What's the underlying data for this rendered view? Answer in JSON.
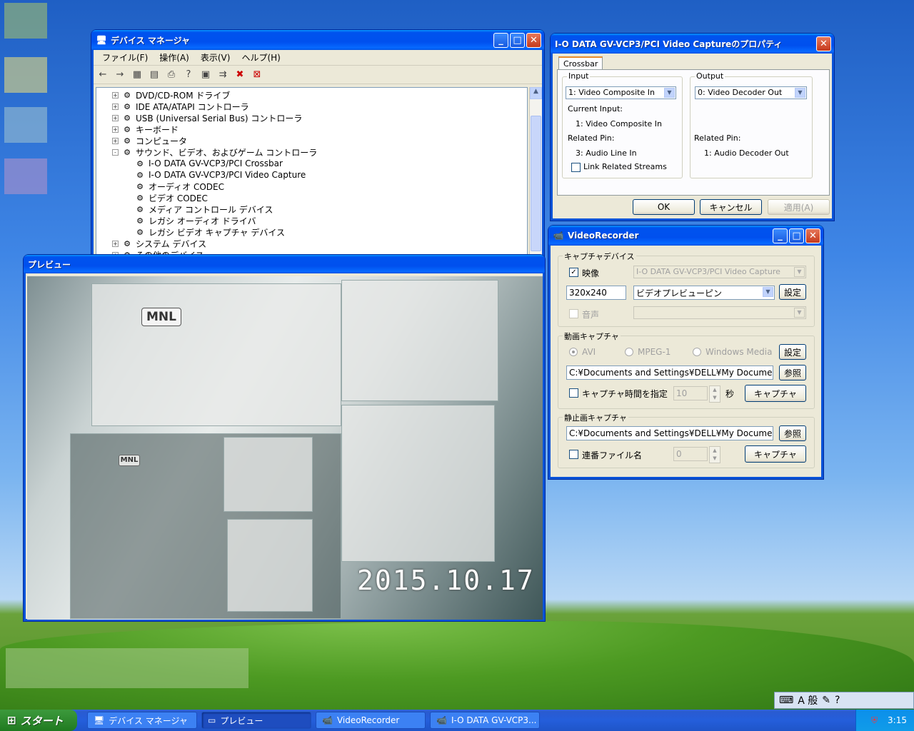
{
  "device_manager": {
    "title": "デバイス マネージャ",
    "menu": [
      "ファイル(F)",
      "操作(A)",
      "表示(V)",
      "ヘルプ(H)"
    ],
    "tree": [
      {
        "label": "DVD/CD-ROM ドライブ",
        "indent": 0,
        "expander": "+"
      },
      {
        "label": "IDE ATA/ATAPI コントローラ",
        "indent": 0,
        "expander": "+"
      },
      {
        "label": "USB (Universal Serial Bus) コントローラ",
        "indent": 0,
        "expander": "+"
      },
      {
        "label": "キーボード",
        "indent": 0,
        "expander": "+"
      },
      {
        "label": "コンピュータ",
        "indent": 0,
        "expander": "+"
      },
      {
        "label": "サウンド、ビデオ、およびゲーム コントローラ",
        "indent": 0,
        "expander": "-"
      },
      {
        "label": "I-O DATA GV-VCP3/PCI Crossbar",
        "indent": 1,
        "expander": ""
      },
      {
        "label": "I-O DATA GV-VCP3/PCI Video Capture",
        "indent": 1,
        "expander": ""
      },
      {
        "label": "オーディオ CODEC",
        "indent": 1,
        "expander": ""
      },
      {
        "label": "ビデオ CODEC",
        "indent": 1,
        "expander": ""
      },
      {
        "label": "メディア コントロール デバイス",
        "indent": 1,
        "expander": ""
      },
      {
        "label": "レガシ オーディオ ドライバ",
        "indent": 1,
        "expander": ""
      },
      {
        "label": "レガシ ビデオ キャプチャ デバイス",
        "indent": 1,
        "expander": ""
      },
      {
        "label": "システム デバイス",
        "indent": 0,
        "expander": "+"
      },
      {
        "label": "その他のデバイス",
        "indent": 0,
        "expander": "+"
      }
    ]
  },
  "properties": {
    "title": "I-O DATA GV-VCP3/PCI Video Captureのプロパティ",
    "tab": "Crossbar",
    "input_group": "Input",
    "input_select": "1: Video Composite In",
    "current_input_label": "Current Input:",
    "current_input_value": "1: Video Composite In",
    "related_pin_label": "Related Pin:",
    "input_related_pin": "3: Audio Line In",
    "link_related_streams": "Link Related Streams",
    "output_group": "Output",
    "output_select": "0: Video Decoder Out",
    "output_related_pin_label": "Related Pin:",
    "output_related_pin": "1: Audio Decoder Out",
    "ok": "OK",
    "cancel": "キャンセル",
    "apply": "適用(A)"
  },
  "video_recorder": {
    "title": "VideoRecorder",
    "capture_device_group": "キャプチャデバイス",
    "video_check": "映像",
    "video_device": "I-O DATA GV-VCP3/PCI Video Capture",
    "resolution": "320x240",
    "pin": "ビデオプレビューピン",
    "settings": "設定",
    "audio_check": "音声",
    "movie_group": "動画キャプチャ",
    "radio_avi": "AVI",
    "radio_mpeg": "MPEG-1",
    "radio_wm": "Windows Media",
    "movie_settings": "設定",
    "movie_path": "C:¥Documents and Settings¥DELL¥My Documents¥CAP",
    "browse": "参照",
    "time_check": "キャプチャ時間を指定",
    "time_value": "10",
    "time_unit": "秒",
    "capture": "キャプチャ",
    "still_group": "静止画キャプチャ",
    "still_path": "C:¥Documents and Settings¥DELL¥My Documents¥CAP",
    "still_browse": "参照",
    "serial_check": "連番ファイル名",
    "serial_value": "0",
    "still_capture": "キャプチャ"
  },
  "preview": {
    "title": "プレビュー",
    "badge": "MNL",
    "badge2": "MNL",
    "date_stamp": "2015.10.17"
  },
  "taskbar": {
    "start": "スタート",
    "tasks": [
      "デバイス マネージャ",
      "プレビュー",
      "VideoRecorder",
      "I-O DATA GV-VCP3..."
    ],
    "clock": "3:15",
    "ime_mode": "A 般"
  }
}
